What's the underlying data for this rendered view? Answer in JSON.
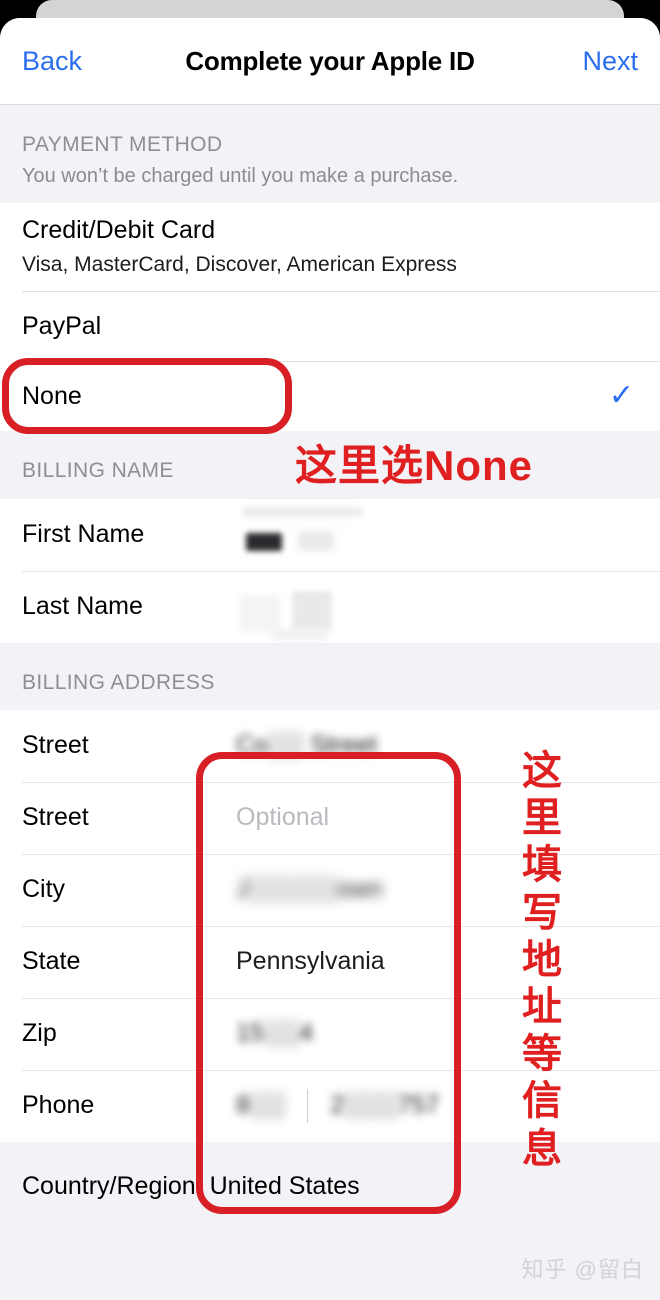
{
  "navbar": {
    "back_label": "Back",
    "title": "Complete your Apple ID",
    "next_label": "Next"
  },
  "payment_section": {
    "title": "PAYMENT METHOD",
    "subtitle": "You won’t be charged until you make a purchase.",
    "options": [
      {
        "label": "Credit/Debit Card",
        "detail": "Visa, MasterCard, Discover, American Express",
        "selected": false
      },
      {
        "label": "PayPal",
        "detail": "",
        "selected": false
      },
      {
        "label": "None",
        "detail": "",
        "selected": true
      }
    ],
    "check_glyph": "✓"
  },
  "billing_name_section": {
    "title": "BILLING NAME",
    "fields": [
      {
        "label": "First Name",
        "value": ""
      },
      {
        "label": "Last Name",
        "value": ""
      }
    ]
  },
  "billing_address_section": {
    "title": "BILLING ADDRESS",
    "fields": [
      {
        "label": "Street",
        "value": "Co░░ Street",
        "placeholder": "",
        "blurred": true
      },
      {
        "label": "Street",
        "value": "",
        "placeholder": "Optional",
        "blurred": false
      },
      {
        "label": "City",
        "value": "J░░░░░own",
        "placeholder": "",
        "blurred": true
      },
      {
        "label": "State",
        "value": "Pennsylvania",
        "placeholder": "",
        "blurred": false
      },
      {
        "label": "Zip",
        "value": "15░░4",
        "placeholder": "",
        "blurred": true
      },
      {
        "label": "Phone",
        "value": "",
        "placeholder": "",
        "blurred": true,
        "phone_code": "8░░",
        "phone_number": "2░░░757"
      }
    ]
  },
  "footer": {
    "country_region": "Country/Region: United States"
  },
  "annotations": {
    "payment_note": "这里选None",
    "address_note": "这里填写地址等信息",
    "color": "#e02020",
    "box_color": "#d81f26"
  },
  "watermark": {
    "text": "知乎 @留白"
  },
  "theme": {
    "accent_blue": "#2b6ef0",
    "group_bg": "#f2f2f7",
    "row_bg": "#ffffff"
  }
}
